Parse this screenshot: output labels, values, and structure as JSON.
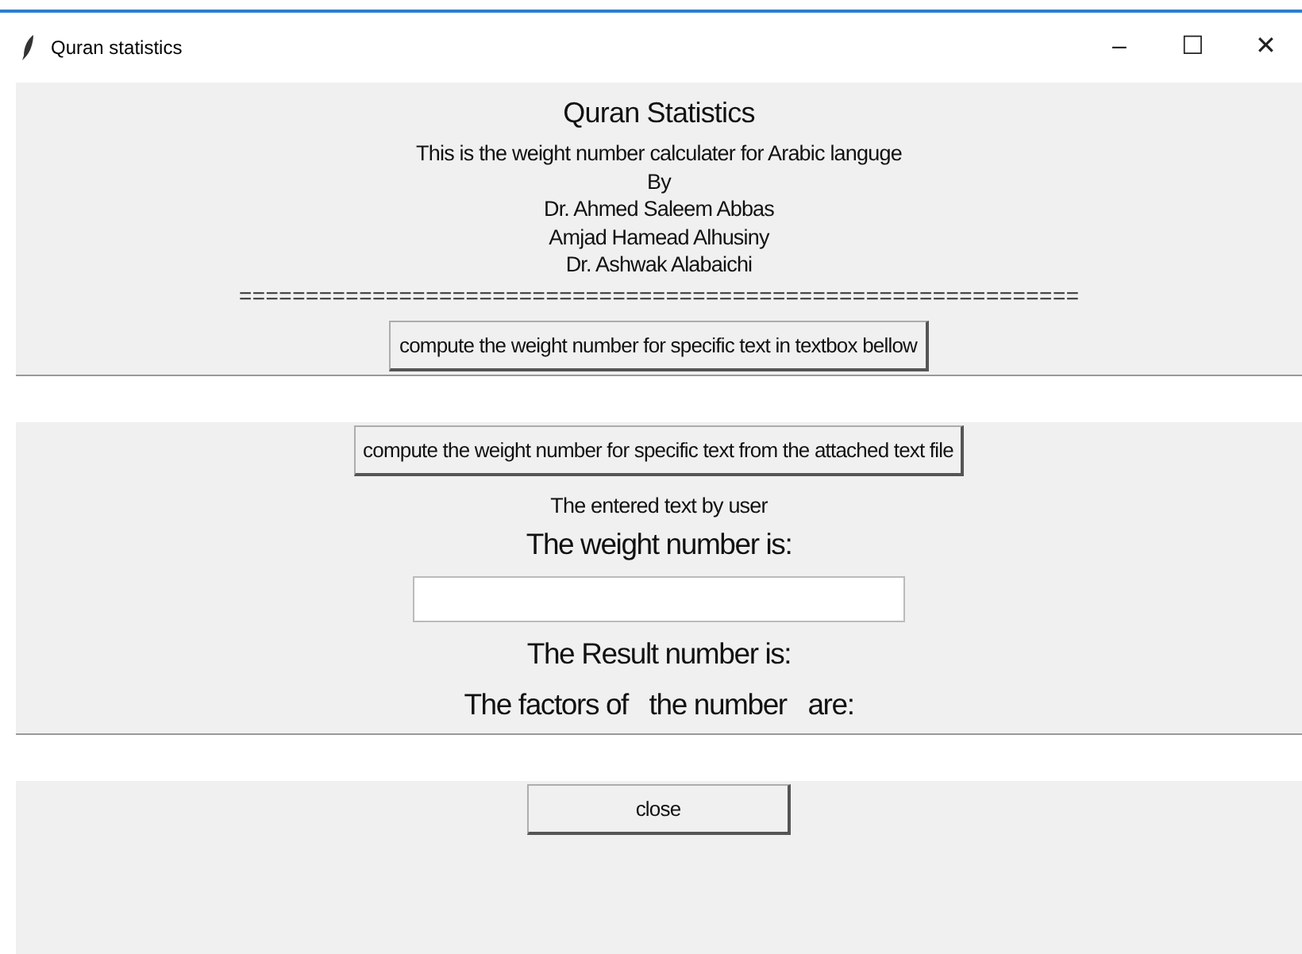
{
  "window": {
    "title": "Quran statistics",
    "controls": [
      "–",
      "☐",
      "✕"
    ]
  },
  "widgets": [
    {
      "kind": "heading",
      "text": "Quran Statistics"
    },
    {
      "kind": "label",
      "text": "This is the weight number calculater for Arabic languge"
    },
    {
      "kind": "label",
      "text": "By"
    },
    {
      "kind": "label",
      "text": "Dr. Ahmed Saleem Abbas"
    },
    {
      "kind": "label",
      "text": "Amjad Hamead Alhusiny"
    },
    {
      "kind": "label",
      "text": "Dr. Ashwak Alabaichi"
    },
    {
      "kind": "separator",
      "text": "==============================================================="
    },
    {
      "kind": "button",
      "text": "compute the weight number for specific text in textbox bellow"
    },
    {
      "kind": "wide-entry"
    },
    {
      "kind": "button",
      "text": "compute the weight number for specific text from the attached text file"
    },
    {
      "kind": "label",
      "text": "The entered text by user"
    },
    {
      "kind": "big-label",
      "text": "The weight number is:"
    },
    {
      "kind": "entry"
    },
    {
      "kind": "big-label",
      "text": "The Result number is:"
    },
    {
      "kind": "big-label",
      "text": "The factors of   the number   are:"
    },
    {
      "kind": "wide-entry"
    },
    {
      "kind": "close-button",
      "text": "close"
    }
  ]
}
